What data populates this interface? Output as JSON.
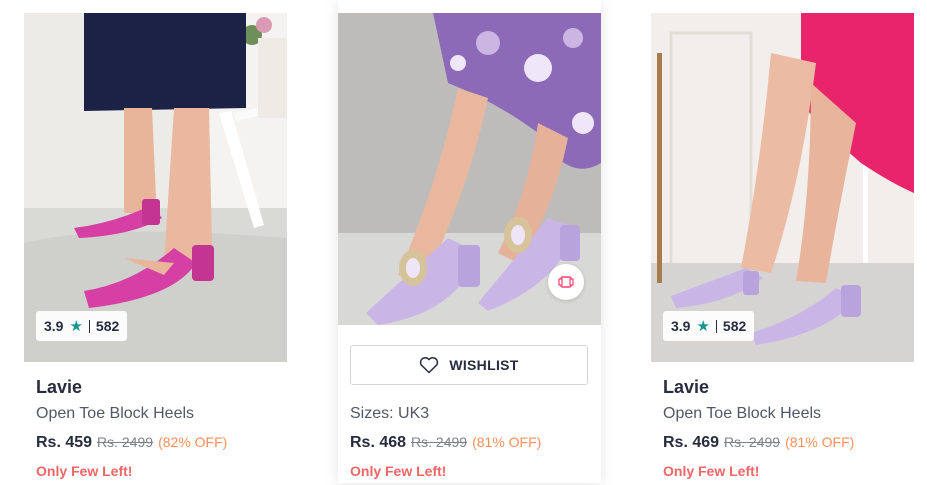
{
  "products": [
    {
      "brand": "Lavie",
      "title": "Open Toe Block Heels",
      "rating": "3.9",
      "rating_count": "582",
      "price": "Rs. 459",
      "mrp": "Rs. 2499",
      "discount": "(82% OFF)",
      "stock_note": "Only Few Left!",
      "heel_color": "#d63fa3"
    },
    {
      "sizes": "Sizes: UK3",
      "wishlist_label": "WISHLIST",
      "price": "Rs. 468",
      "mrp": "Rs. 2499",
      "discount": "(81% OFF)",
      "stock_note": "Only Few Left!",
      "heel_color": "#c9b6e6"
    },
    {
      "brand": "Lavie",
      "title": "Open Toe Block Heels",
      "rating": "3.9",
      "rating_count": "582",
      "price": "Rs. 469",
      "mrp": "Rs. 2499",
      "discount": "(81% OFF)",
      "stock_note": "Only Few Left!",
      "heel_color": "#c9b6e6"
    }
  ],
  "colors": {
    "rating_star": "#14958f",
    "discount": "#ff905a",
    "stock_note": "#f16565"
  }
}
